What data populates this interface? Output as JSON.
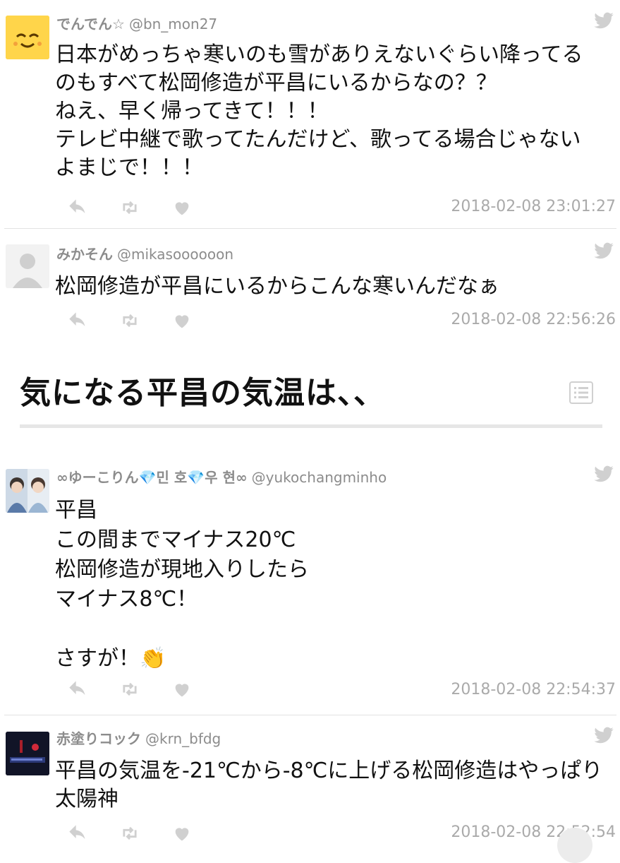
{
  "tweets": [
    {
      "name": "でんでん☆",
      "handle": "@bn_mon27",
      "text": "日本がめっちゃ寒いのも雪がありえないぐらい降ってる\nのもすべて松岡修造が平昌にいるからなの？？\nねえ、早く帰ってきて！！！\nテレビ中継で歌ってたんだけど、歌ってる場合じゃない\nよまじで！！！",
      "timestamp": "2018-02-08 23:01:27"
    },
    {
      "name": "みかそん",
      "handle": "@mikasoooooon",
      "text": "松岡修造が平昌にいるからこんな寒いんだなぁ",
      "timestamp": "2018-02-08 22:56:26"
    },
    {
      "name": "∞ゆーこりん💎민 호💎우 현∞",
      "handle": "@yukochangminho",
      "text": "平昌\nこの間までマイナス20℃\n松岡修造が現地入りしたら\nマイナス8℃！\n\nさすが！👏",
      "timestamp": "2018-02-08 22:54:37"
    },
    {
      "name": "赤塗りコック",
      "handle": "@krn_bfdg",
      "text": "平昌の気温を-21℃から-8℃に上げる松岡修造はやっぱり\n太陽神",
      "timestamp": "2018-02-08 22:52:54"
    }
  ],
  "section": {
    "title": "気になる平昌の気温は、、"
  },
  "icons": {
    "bird": "twitter-bird-icon",
    "reply": "reply-icon",
    "retweet": "retweet-icon",
    "like": "heart-icon",
    "list": "list-icon"
  },
  "colors": {
    "muted": "#8c8c8c",
    "icon": "#d0d0d0",
    "timestamp": "#aaaaaa"
  }
}
